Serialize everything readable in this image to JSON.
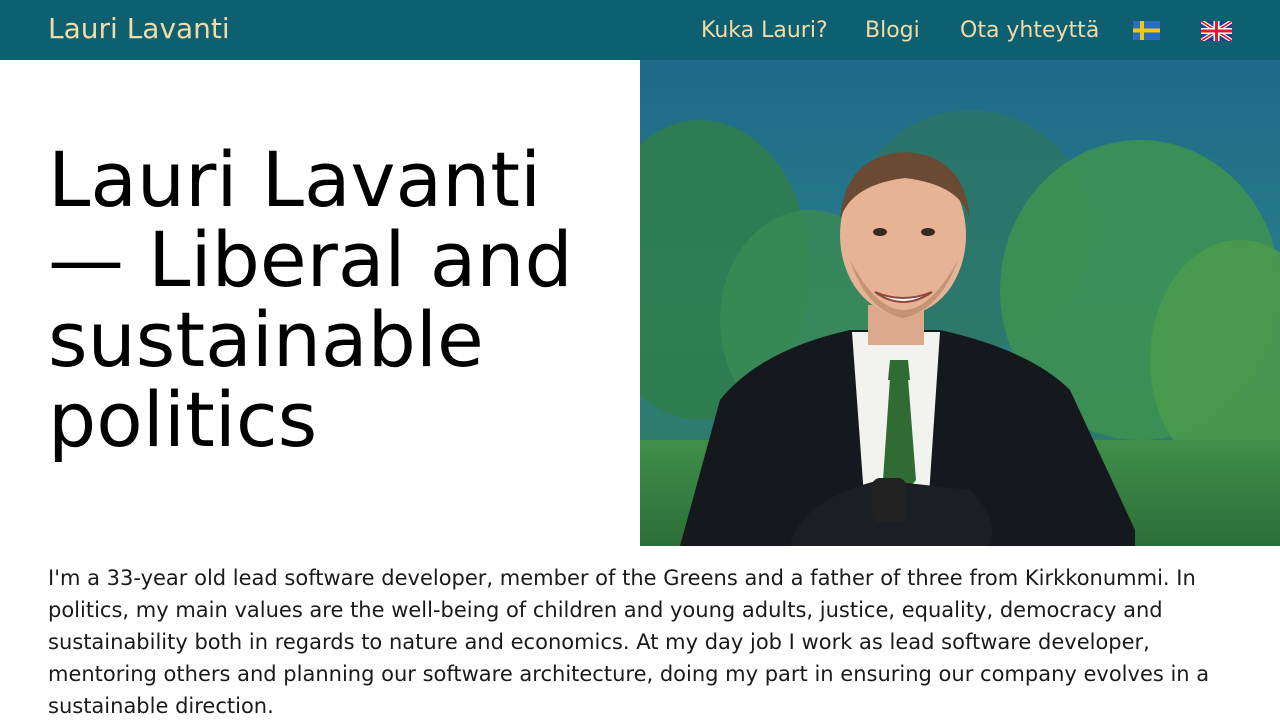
{
  "header": {
    "brand": "Lauri Lavanti",
    "nav": [
      {
        "label": "Kuka Lauri?"
      },
      {
        "label": "Blogi"
      },
      {
        "label": "Ota yhteyttä"
      }
    ],
    "languages": [
      {
        "icon": "swedish-flag-icon"
      },
      {
        "icon": "uk-flag-icon"
      }
    ]
  },
  "hero": {
    "title": "Lauri Lavanti — Liberal and sustainable politics"
  },
  "intro": {
    "text": "I'm a 33-year old lead software developer, member of the Greens and a father of three from Kirkkonummi. In politics, my main values are the well-being of children and young adults, justice, equality, democracy and sustainability both in regards to nature and economics. At my day job I work as lead software developer, mentoring others and planning our software architecture, doing my part in ensuring our company evolves in a sustainable direction."
  },
  "colors": {
    "header_bg": "#0e5f70",
    "header_text": "#f0dca8"
  }
}
